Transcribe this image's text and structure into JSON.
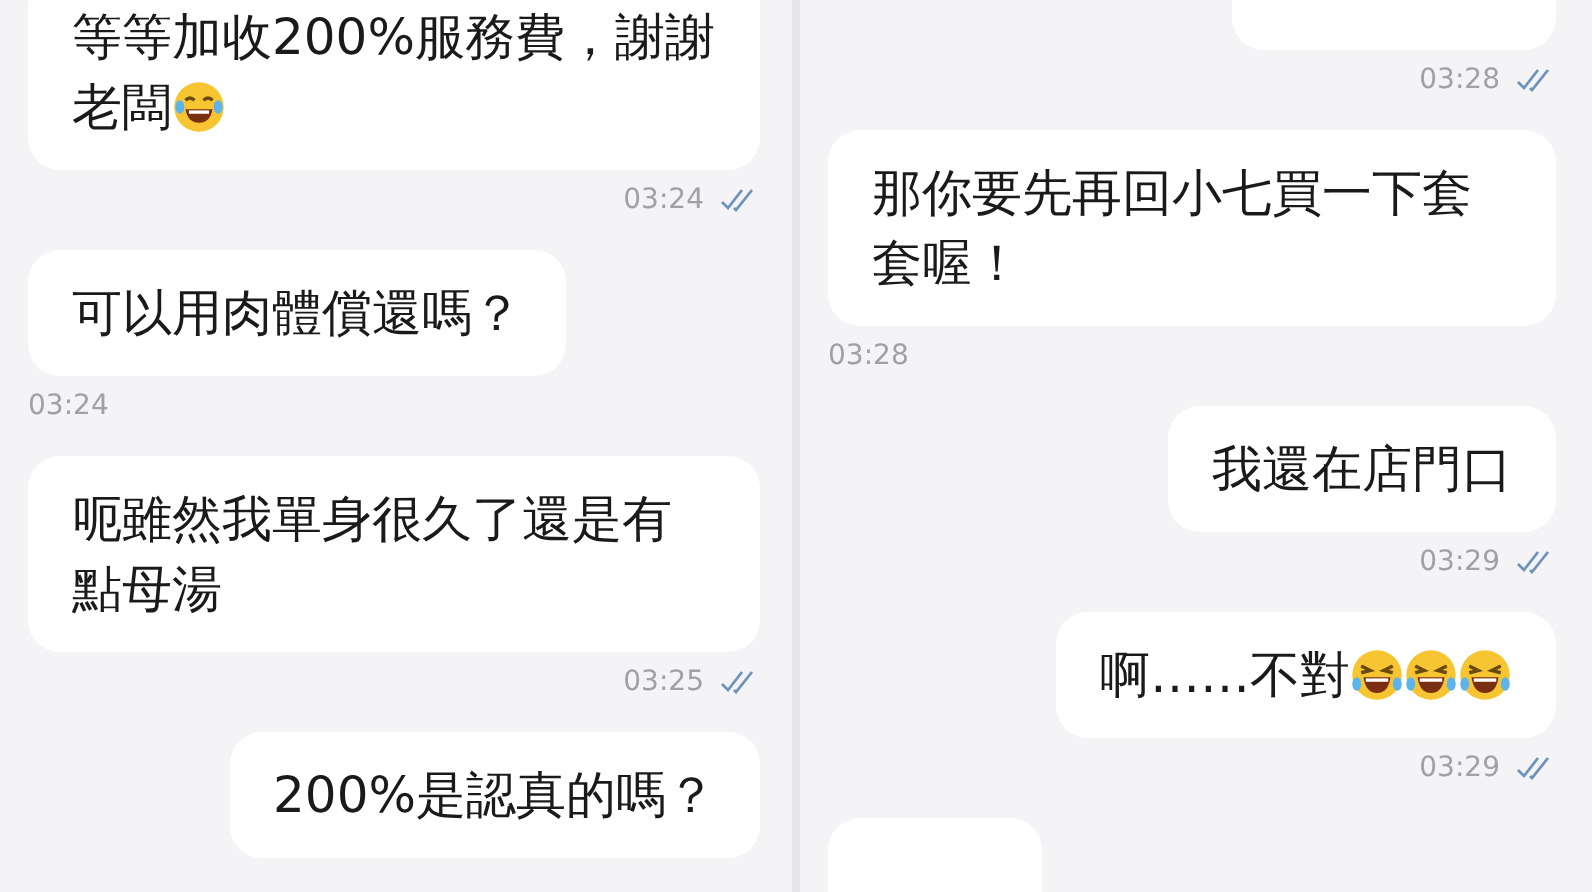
{
  "panels": [
    {
      "messages": [
        {
          "kind": "out",
          "text": "等等加收200%服務費，謝謝老闆",
          "emojis": [
            {
              "kind": "tears_of_joy"
            }
          ],
          "time": "03:24",
          "read": true
        },
        {
          "kind": "in",
          "text": "可以用肉體償還嗎？",
          "time": "03:24"
        },
        {
          "kind": "out",
          "text": "呃雖然我單身很久了還是有點母湯",
          "time": "03:25",
          "read": true
        },
        {
          "kind": "out",
          "text": "200%是認真的嗎？"
        }
      ]
    },
    {
      "messages": [
        {
          "kind": "out",
          "time": "03:28",
          "read": true
        },
        {
          "kind": "in",
          "text": "那你要先再回小七買一下套套喔！",
          "time": "03:28"
        },
        {
          "kind": "out",
          "text": "我還在店門口",
          "time": "03:29",
          "read": true
        },
        {
          "kind": "out",
          "text": "啊……不對",
          "emojis": [
            {
              "kind": "rolling_laugh"
            },
            {
              "kind": "rolling_laugh"
            },
            {
              "kind": "rolling_laugh"
            }
          ],
          "time": "03:29",
          "read": true
        },
        {
          "kind": "in"
        }
      ]
    }
  ]
}
